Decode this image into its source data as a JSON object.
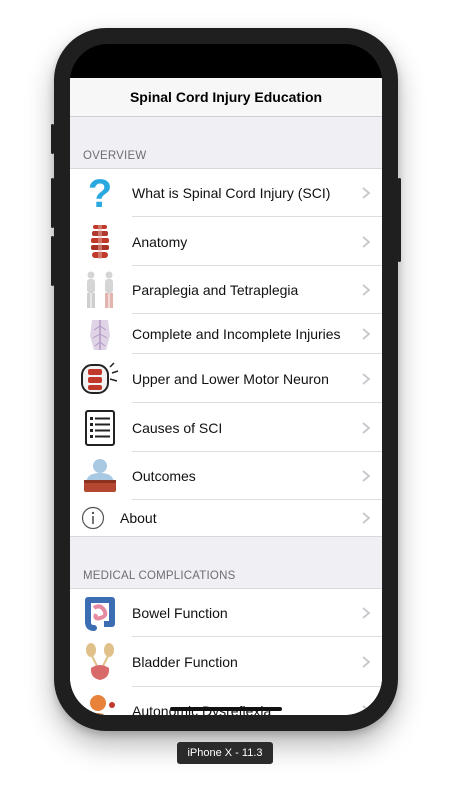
{
  "app": {
    "title": "Spinal Cord Injury Education"
  },
  "sections": [
    {
      "header": "OVERVIEW",
      "items": [
        {
          "label": "What is Spinal Cord Injury (SCI)",
          "icon": "question-mark-icon"
        },
        {
          "label": "Anatomy",
          "icon": "spine-icon"
        },
        {
          "label": "Paraplegia and Tetraplegia",
          "icon": "body-figures-icon"
        },
        {
          "label": "Complete and Incomplete Injuries",
          "icon": "torso-nerves-icon"
        },
        {
          "label": "Upper and Lower Motor Neuron",
          "icon": "motor-neuron-icon"
        },
        {
          "label": "Causes of SCI",
          "icon": "checklist-icon"
        },
        {
          "label": "Outcomes",
          "icon": "patient-icon"
        },
        {
          "label": "About",
          "icon": "info-icon"
        }
      ]
    },
    {
      "header": "MEDICAL COMPLICATIONS",
      "items": [
        {
          "label": "Bowel Function",
          "icon": "bowel-icon"
        },
        {
          "label": "Bladder Function",
          "icon": "bladder-icon"
        },
        {
          "label": "Autonomic Dysreflexia",
          "icon": "autonomic-icon"
        }
      ]
    }
  ],
  "device": {
    "label": "iPhone X - 11.3"
  },
  "colors": {
    "accent_blue": "#29a9e0",
    "section_bg": "#efeff4",
    "chevron": "#c7c7cc"
  }
}
